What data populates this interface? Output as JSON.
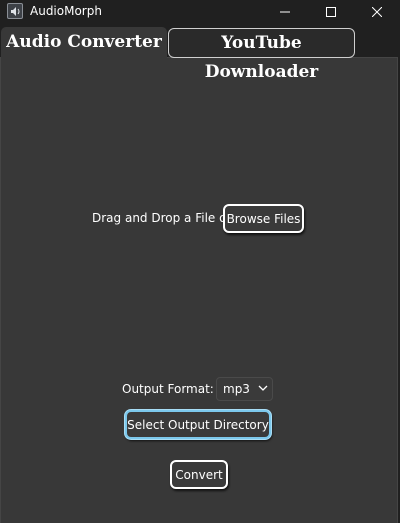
{
  "window": {
    "title": "AudioMorph",
    "minimize_glyph": "—",
    "maximize_glyph": "☐",
    "close_glyph": "✕"
  },
  "tabs": [
    {
      "label": "Audio Converter",
      "active": true
    },
    {
      "label": "YouTube Downloader",
      "active": false
    }
  ],
  "converter": {
    "drop_text": "Drag and Drop a File or",
    "browse_label": "Browse Files",
    "format_label": "Output Format:",
    "format_value": "mp3",
    "output_dir_label": "Select Output Directory",
    "convert_label": "Convert"
  },
  "colors": {
    "panel_bg": "#383838",
    "window_bg": "#202020",
    "focus_border": "#7cc8ec"
  }
}
